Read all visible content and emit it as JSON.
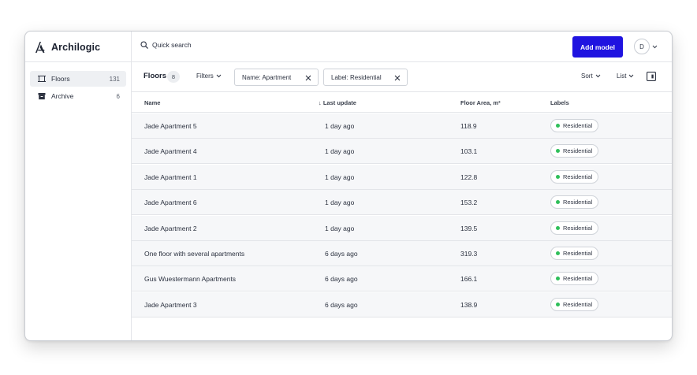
{
  "app": {
    "name": "Archilogic",
    "logo_icon": "archilogic-logo-icon"
  },
  "header": {
    "search_label": "Quick search",
    "search_icon": "search-icon",
    "add_button_label": "Add model",
    "avatar_initial": "D",
    "accent_color": "#1f13e0"
  },
  "sidebar": {
    "items": [
      {
        "label": "Floors",
        "count": "131",
        "icon": "floor-plan-icon",
        "active": true
      },
      {
        "label": "Archive",
        "count": "6",
        "icon": "archive-box-icon",
        "active": false
      }
    ]
  },
  "toolbar": {
    "title": "Floors",
    "count": "8",
    "filters_label": "Filters",
    "chips": [
      {
        "label": "Name: Apartment"
      },
      {
        "label": "Label: Residential"
      }
    ],
    "sort_label": "Sort",
    "view_label": "List"
  },
  "table": {
    "columns": [
      "Name",
      "↓ Last update",
      "Floor Area, m²",
      "Labels"
    ],
    "label_dot_color": "#2fbf5a",
    "rows": [
      {
        "name": "Jade Apartment 5",
        "updated": "1 day ago",
        "area": "118.9",
        "label": "Residential"
      },
      {
        "name": "Jade Apartment 4",
        "updated": "1 day ago",
        "area": "103.1",
        "label": "Residential"
      },
      {
        "name": "Jade Apartment 1",
        "updated": "1 day ago",
        "area": "122.8",
        "label": "Residential"
      },
      {
        "name": "Jade Apartment 6",
        "updated": "1 day ago",
        "area": "153.2",
        "label": "Residential"
      },
      {
        "name": "Jade Apartment 2",
        "updated": "1 day ago",
        "area": "139.5",
        "label": "Residential"
      },
      {
        "name": "One floor with several apartments",
        "updated": "6 days ago",
        "area": "319.3",
        "label": "Residential"
      },
      {
        "name": "Gus Wuestermann Apartments",
        "updated": "6 days ago",
        "area": "166.1",
        "label": "Residential"
      },
      {
        "name": "Jade Apartment 3",
        "updated": "6 days ago",
        "area": "138.9",
        "label": "Residential"
      }
    ]
  }
}
